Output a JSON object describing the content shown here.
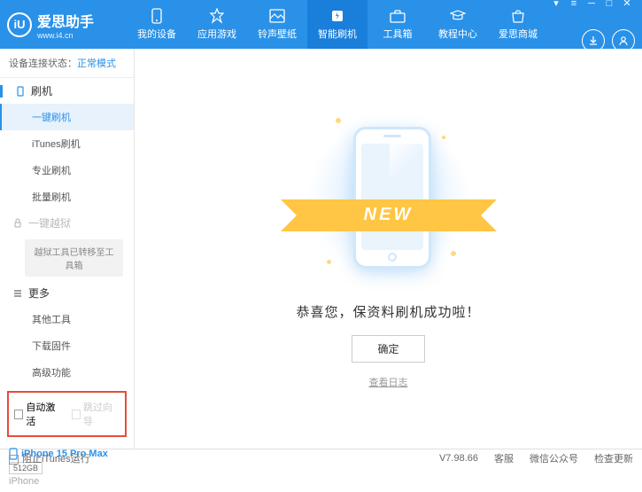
{
  "app": {
    "name": "爱思助手",
    "url": "www.i4.cn",
    "logo_letter": "iU"
  },
  "topnav": [
    {
      "label": "我的设备"
    },
    {
      "label": "应用游戏"
    },
    {
      "label": "铃声壁纸"
    },
    {
      "label": "智能刷机"
    },
    {
      "label": "工具箱"
    },
    {
      "label": "教程中心"
    },
    {
      "label": "爱思商城"
    }
  ],
  "status": {
    "label": "设备连接状态：",
    "value": "正常模式"
  },
  "sidebar": {
    "flash_head": "刷机",
    "flash_items": [
      "一键刷机",
      "iTunes刷机",
      "专业刷机",
      "批量刷机"
    ],
    "jailbreak_head": "一键越狱",
    "jailbreak_box": "越狱工具已转移至工具箱",
    "more_head": "更多",
    "more_items": [
      "其他工具",
      "下载固件",
      "高级功能"
    ]
  },
  "checkboxes": {
    "auto_activate": "自动激活",
    "skip_guide": "跳过向导"
  },
  "device": {
    "name": "iPhone 15 Pro Max",
    "storage": "512GB",
    "model": "iPhone"
  },
  "main": {
    "ribbon": "NEW",
    "success": "恭喜您，保资料刷机成功啦！",
    "ok": "确定",
    "log": "查看日志"
  },
  "footer": {
    "block_itunes": "阻止iTunes运行",
    "version": "V7.98.66",
    "service": "客服",
    "wechat": "微信公众号",
    "update": "检查更新"
  }
}
